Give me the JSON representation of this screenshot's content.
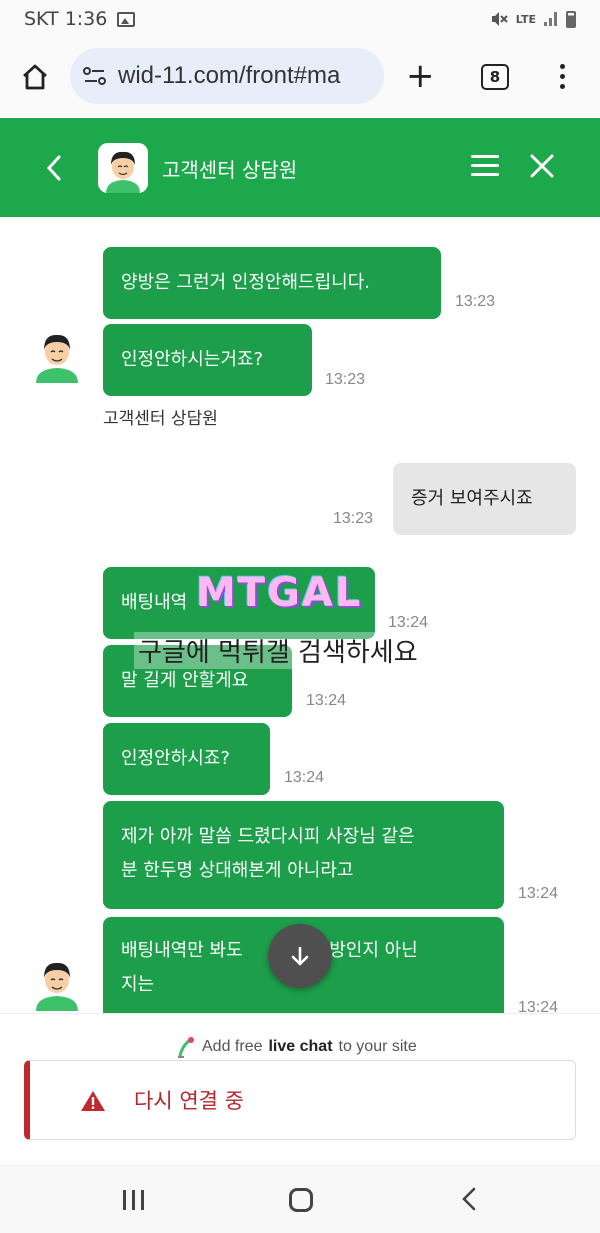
{
  "status_bar": {
    "carrier_time": "SKT 1:36",
    "network": "LTE"
  },
  "browser": {
    "url": "wid-11.com/front#ma",
    "tab_count": "8"
  },
  "header": {
    "title": "고객센터 상담원"
  },
  "messages": {
    "m1": {
      "text": "양방은 그런거 인정안해드립니다.",
      "time": "13:23"
    },
    "m2": {
      "text": "인정안하시는거죠?",
      "time": "13:23"
    },
    "agent_name_1": "고객센터 상담원",
    "u1": {
      "text": "증거 보여주시죠",
      "time": "13:23"
    },
    "m3": {
      "text": "배팅내역",
      "time": "13:24"
    },
    "m4": {
      "text": "말 길게 안할게요",
      "time": "13:24"
    },
    "m5": {
      "text": "인정안하시죠?",
      "time": "13:24"
    },
    "m6": {
      "line1": "제가 아까 말씀 드렸다시피 사장님 같은",
      "line2": "분 한두명 상대해본게 아니라고",
      "time": "13:24"
    },
    "m7": {
      "line1": "배팅내역만 봐도",
      "line1b": "양방인지 아닌",
      "line2": "지는",
      "time": "13:24"
    }
  },
  "watermark": {
    "logo": "MTGAL",
    "text": "구글에 먹튀갤 검색하세요"
  },
  "footer": {
    "powered_prefix": "Add free",
    "powered_bold": "live chat",
    "powered_suffix": "to your site",
    "reconnect_text": "다시 연결 중"
  },
  "colors": {
    "brand_green": "#1ea84c",
    "bubble_green": "#1c9e4a",
    "error_red": "#c0282d"
  }
}
